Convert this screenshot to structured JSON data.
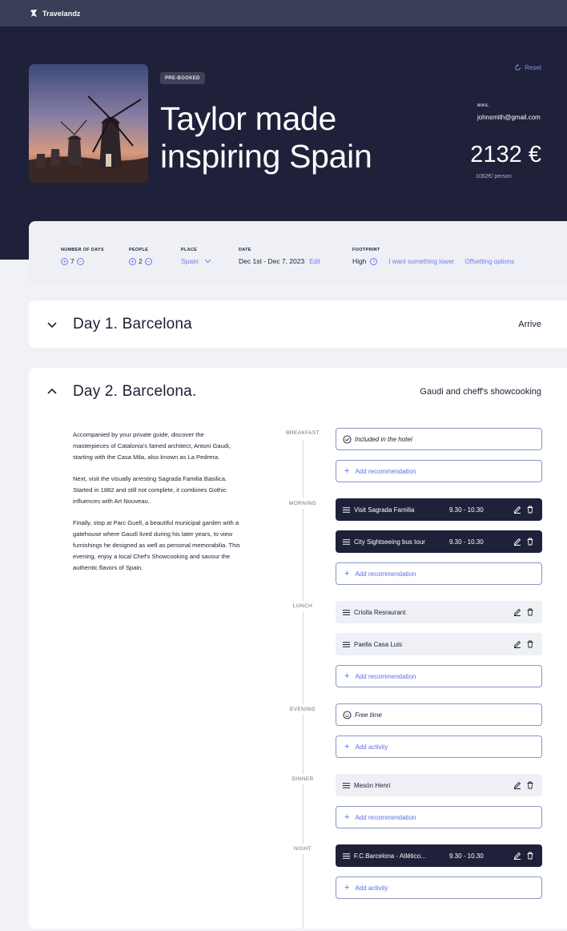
{
  "app": {
    "name": "Travelandz"
  },
  "hero": {
    "badge": "PRE-BOOKED",
    "title": "Taylor made inspiring Spain",
    "reset_label": "Reset",
    "mail_label": "MAIL",
    "mail_value": "johnsmith@gmail.com",
    "price": "2132 €",
    "per_person": "1062€/ person"
  },
  "summary": {
    "days": {
      "label": "NUMBER OF DAYS",
      "value": "7"
    },
    "people": {
      "label": "PEOPLE",
      "value": "2"
    },
    "place": {
      "label": "PLACE",
      "value": "Spain"
    },
    "date": {
      "label": "DATE",
      "value": "Dec 1st - Dec 7, 2023",
      "edit": "Edit"
    },
    "footprint": {
      "label": "FOOTPRINT",
      "value": "High",
      "lower": "I want something lower",
      "offset": "Offsetting options"
    }
  },
  "day1": {
    "title": "Day 1. Barcelona",
    "right": "Arrive"
  },
  "day2": {
    "title": "Day 2. Barcelona.",
    "right": "Gaudi and cheff's showcooking",
    "paragraphs": [
      "Accompanied by your private guide, discover the masterpieces of Catalonia's famed architect, Antoni Gaudi, starting with the Casa Mila, also known as La Pedrera.",
      "Next, visit the visually arresting Sagrada Familia Basilica. Started in 1882 and still not complete, it combines Gothic influences with Art Nouveau.",
      "Finally, stop at Parc Guell, a beautiful municipal garden with a gatehouse where Gaudí lived during his later years, to view furnishings he designed as well as personal memorabilia. This evening, enjoy a local Chef's Showcooking and savour the authentic flavors of Spain."
    ],
    "slots": {
      "breakfast": "BREAKFAST",
      "morning": "MORNING",
      "lunch": "LUNCH",
      "evening": "EVENING",
      "dinner": "DINNER",
      "night": "NIGHT"
    },
    "items": {
      "breakfast_included": "Included in the hotel",
      "add_recommendation": "Add recommendation",
      "add_activity": "Add activity",
      "sagrada": {
        "name": "Visit Sagrada Familia",
        "time": "9.30 - 10.30"
      },
      "bus": {
        "name": "City Sightseeing bus tour",
        "time": "9.30 - 10.30"
      },
      "criolla": "Criolla Resraurant",
      "paella": "Paella Casa Luis",
      "free_time": "Free time",
      "meson": "Mesón Henri",
      "fcb": {
        "name": "F.C.Barcelona - Atlético...",
        "time": "9.30 - 10.30"
      }
    }
  }
}
